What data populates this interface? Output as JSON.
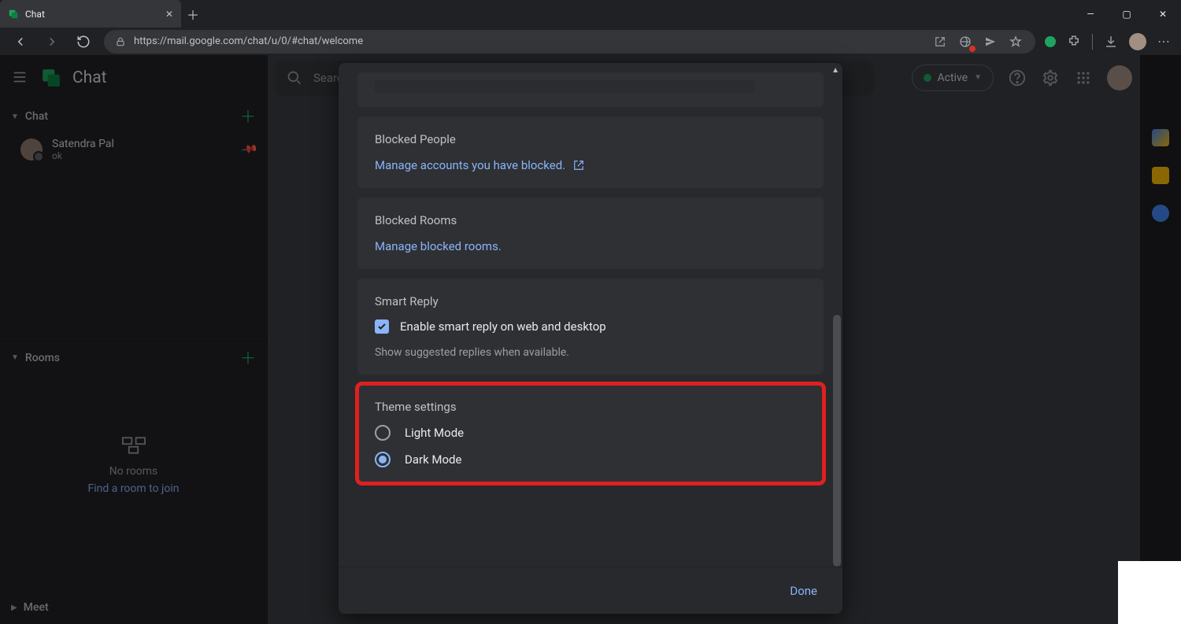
{
  "browser": {
    "tab_title": "Chat",
    "url": "https://mail.google.com/chat/u/0/#chat/welcome"
  },
  "app": {
    "title": "Chat",
    "status_label": "Active",
    "search_placeholder": "Search"
  },
  "sidebar": {
    "chat_label": "Chat",
    "rooms_label": "Rooms",
    "meet_label": "Meet",
    "contact": {
      "name": "Satendra Pal",
      "preview": "ok"
    },
    "rooms_empty_title": "No rooms",
    "rooms_empty_link": "Find a room to join"
  },
  "settings": {
    "blocked_people_title": "Blocked People",
    "blocked_people_link": "Manage accounts you have blocked.",
    "blocked_rooms_title": "Blocked Rooms",
    "blocked_rooms_link": "Manage blocked rooms.",
    "smart_reply_title": "Smart Reply",
    "smart_reply_check": "Enable smart reply on web and desktop",
    "smart_reply_desc": "Show suggested replies when available.",
    "theme_title": "Theme settings",
    "theme_light": "Light Mode",
    "theme_dark": "Dark Mode",
    "done": "Done"
  }
}
